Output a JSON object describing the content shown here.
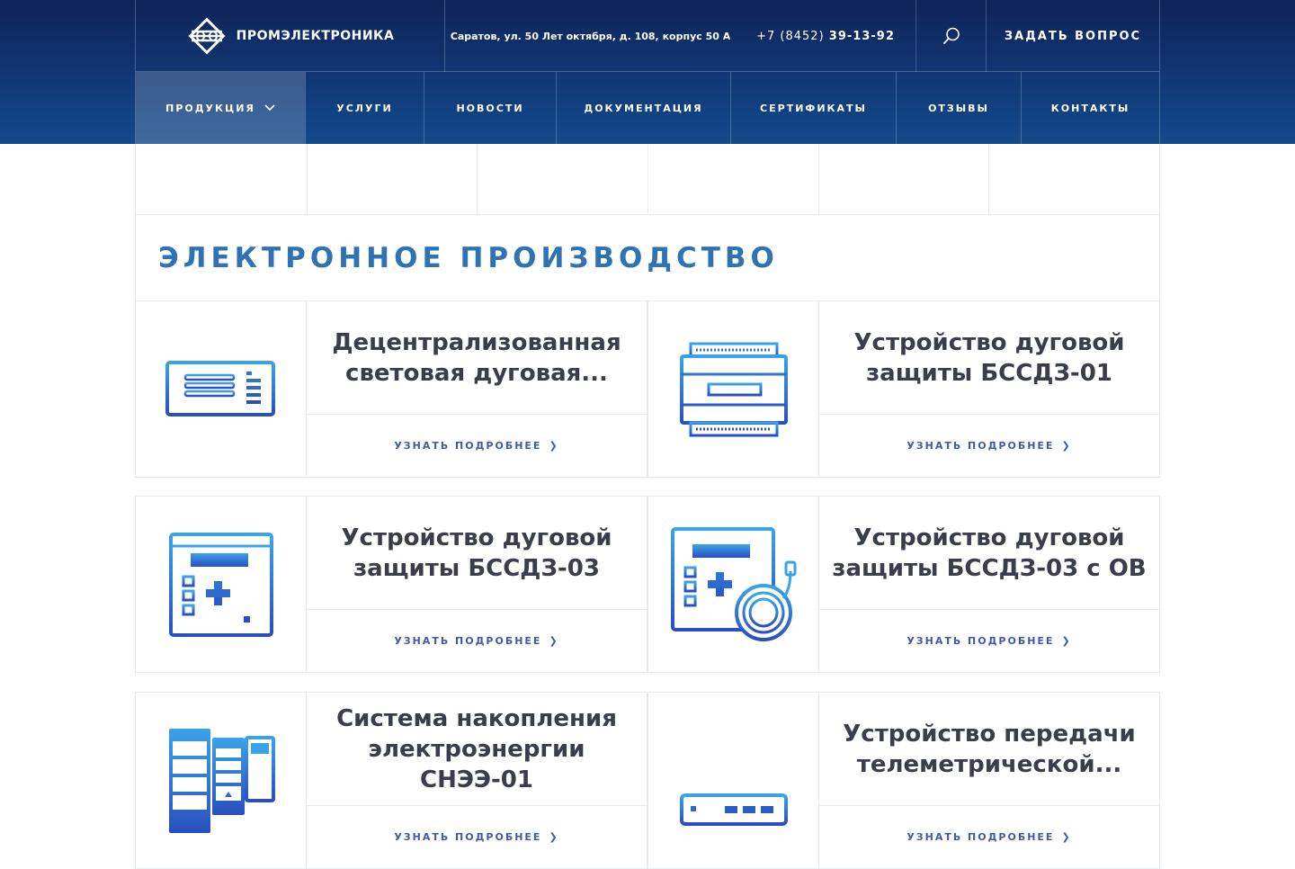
{
  "header": {
    "logo_text": "ПРОМЭЛЕКТРОНИКА",
    "address": "Саратов, ул. 50 Лет октября, д. 108, корпус 50 А",
    "phone_prefix": "+7 (8452)",
    "phone_number": "39-13-92",
    "ask_button": "ЗАДАТЬ ВОПРОС"
  },
  "nav": {
    "items": [
      {
        "label": "ПРОДУКЦИЯ"
      },
      {
        "label": "УСЛУГИ"
      },
      {
        "label": "НОВОСТИ"
      },
      {
        "label": "ДОКУМЕНТАЦИЯ"
      },
      {
        "label": "СЕРТИФИКАТЫ"
      },
      {
        "label": "ОТЗЫВЫ"
      },
      {
        "label": "КОНТАКТЫ"
      }
    ]
  },
  "section": {
    "title": "ЭЛЕКТРОННОЕ ПРОИЗВОДСТВО"
  },
  "products": [
    {
      "title": "Децентрализованная световая дуговая...",
      "more": "УЗНАТЬ ПОДРОБНЕЕ",
      "icon": "panel-device-icon"
    },
    {
      "title": "Устройство дуговой защиты БССДЗ-01",
      "more": "УЗНАТЬ ПОДРОБНЕЕ",
      "icon": "din-rail-device-icon"
    },
    {
      "title": "Устройство дуговой защиты БССДЗ-03",
      "more": "УЗНАТЬ ПОДРОБНЕЕ",
      "icon": "control-panel-icon"
    },
    {
      "title": "Устройство дуговой защиты БССДЗ-03 с ОВ",
      "more": "УЗНАТЬ ПОДРОБНЕЕ",
      "icon": "control-panel-fiber-icon"
    },
    {
      "title": "Система накопления электроэнергии СНЭЭ-01",
      "more": "УЗНАТЬ ПОДРОБНЕЕ",
      "icon": "energy-storage-icon"
    },
    {
      "title": "Устройство передачи телеметрической...",
      "more": "УЗНАТЬ ПОДРОБНЕЕ",
      "icon": "router-icon"
    }
  ],
  "colors": {
    "header_dark": "#0f2358",
    "header_light": "#134a8c",
    "accent_blue": "#2f73b5",
    "link_blue": "#3e5aa8",
    "title_text": "#3a3d4a"
  }
}
